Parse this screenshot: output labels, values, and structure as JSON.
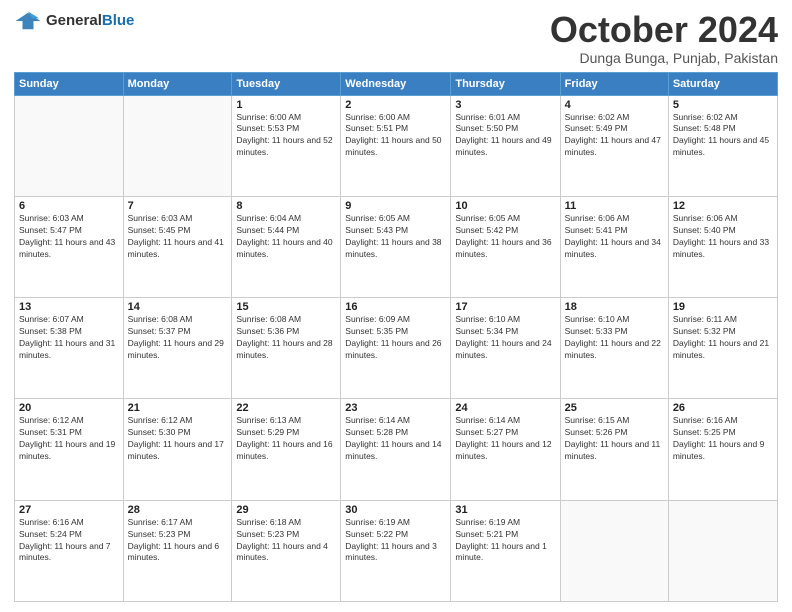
{
  "header": {
    "logo_general": "General",
    "logo_blue": "Blue",
    "month": "October 2024",
    "location": "Dunga Bunga, Punjab, Pakistan"
  },
  "weekdays": [
    "Sunday",
    "Monday",
    "Tuesday",
    "Wednesday",
    "Thursday",
    "Friday",
    "Saturday"
  ],
  "weeks": [
    [
      {
        "day": "",
        "info": ""
      },
      {
        "day": "",
        "info": ""
      },
      {
        "day": "1",
        "info": "Sunrise: 6:00 AM\nSunset: 5:53 PM\nDaylight: 11 hours and 52 minutes."
      },
      {
        "day": "2",
        "info": "Sunrise: 6:00 AM\nSunset: 5:51 PM\nDaylight: 11 hours and 50 minutes."
      },
      {
        "day": "3",
        "info": "Sunrise: 6:01 AM\nSunset: 5:50 PM\nDaylight: 11 hours and 49 minutes."
      },
      {
        "day": "4",
        "info": "Sunrise: 6:02 AM\nSunset: 5:49 PM\nDaylight: 11 hours and 47 minutes."
      },
      {
        "day": "5",
        "info": "Sunrise: 6:02 AM\nSunset: 5:48 PM\nDaylight: 11 hours and 45 minutes."
      }
    ],
    [
      {
        "day": "6",
        "info": "Sunrise: 6:03 AM\nSunset: 5:47 PM\nDaylight: 11 hours and 43 minutes."
      },
      {
        "day": "7",
        "info": "Sunrise: 6:03 AM\nSunset: 5:45 PM\nDaylight: 11 hours and 41 minutes."
      },
      {
        "day": "8",
        "info": "Sunrise: 6:04 AM\nSunset: 5:44 PM\nDaylight: 11 hours and 40 minutes."
      },
      {
        "day": "9",
        "info": "Sunrise: 6:05 AM\nSunset: 5:43 PM\nDaylight: 11 hours and 38 minutes."
      },
      {
        "day": "10",
        "info": "Sunrise: 6:05 AM\nSunset: 5:42 PM\nDaylight: 11 hours and 36 minutes."
      },
      {
        "day": "11",
        "info": "Sunrise: 6:06 AM\nSunset: 5:41 PM\nDaylight: 11 hours and 34 minutes."
      },
      {
        "day": "12",
        "info": "Sunrise: 6:06 AM\nSunset: 5:40 PM\nDaylight: 11 hours and 33 minutes."
      }
    ],
    [
      {
        "day": "13",
        "info": "Sunrise: 6:07 AM\nSunset: 5:38 PM\nDaylight: 11 hours and 31 minutes."
      },
      {
        "day": "14",
        "info": "Sunrise: 6:08 AM\nSunset: 5:37 PM\nDaylight: 11 hours and 29 minutes."
      },
      {
        "day": "15",
        "info": "Sunrise: 6:08 AM\nSunset: 5:36 PM\nDaylight: 11 hours and 28 minutes."
      },
      {
        "day": "16",
        "info": "Sunrise: 6:09 AM\nSunset: 5:35 PM\nDaylight: 11 hours and 26 minutes."
      },
      {
        "day": "17",
        "info": "Sunrise: 6:10 AM\nSunset: 5:34 PM\nDaylight: 11 hours and 24 minutes."
      },
      {
        "day": "18",
        "info": "Sunrise: 6:10 AM\nSunset: 5:33 PM\nDaylight: 11 hours and 22 minutes."
      },
      {
        "day": "19",
        "info": "Sunrise: 6:11 AM\nSunset: 5:32 PM\nDaylight: 11 hours and 21 minutes."
      }
    ],
    [
      {
        "day": "20",
        "info": "Sunrise: 6:12 AM\nSunset: 5:31 PM\nDaylight: 11 hours and 19 minutes."
      },
      {
        "day": "21",
        "info": "Sunrise: 6:12 AM\nSunset: 5:30 PM\nDaylight: 11 hours and 17 minutes."
      },
      {
        "day": "22",
        "info": "Sunrise: 6:13 AM\nSunset: 5:29 PM\nDaylight: 11 hours and 16 minutes."
      },
      {
        "day": "23",
        "info": "Sunrise: 6:14 AM\nSunset: 5:28 PM\nDaylight: 11 hours and 14 minutes."
      },
      {
        "day": "24",
        "info": "Sunrise: 6:14 AM\nSunset: 5:27 PM\nDaylight: 11 hours and 12 minutes."
      },
      {
        "day": "25",
        "info": "Sunrise: 6:15 AM\nSunset: 5:26 PM\nDaylight: 11 hours and 11 minutes."
      },
      {
        "day": "26",
        "info": "Sunrise: 6:16 AM\nSunset: 5:25 PM\nDaylight: 11 hours and 9 minutes."
      }
    ],
    [
      {
        "day": "27",
        "info": "Sunrise: 6:16 AM\nSunset: 5:24 PM\nDaylight: 11 hours and 7 minutes."
      },
      {
        "day": "28",
        "info": "Sunrise: 6:17 AM\nSunset: 5:23 PM\nDaylight: 11 hours and 6 minutes."
      },
      {
        "day": "29",
        "info": "Sunrise: 6:18 AM\nSunset: 5:23 PM\nDaylight: 11 hours and 4 minutes."
      },
      {
        "day": "30",
        "info": "Sunrise: 6:19 AM\nSunset: 5:22 PM\nDaylight: 11 hours and 3 minutes."
      },
      {
        "day": "31",
        "info": "Sunrise: 6:19 AM\nSunset: 5:21 PM\nDaylight: 11 hours and 1 minute."
      },
      {
        "day": "",
        "info": ""
      },
      {
        "day": "",
        "info": ""
      }
    ]
  ]
}
